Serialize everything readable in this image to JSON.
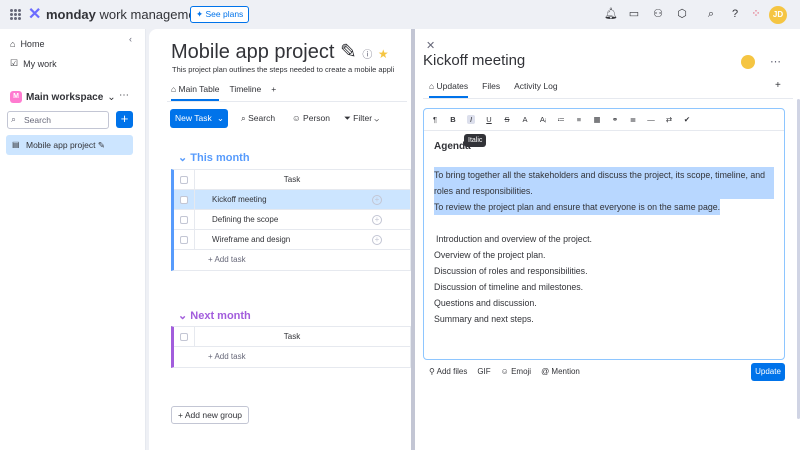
{
  "topbar": {
    "brand_bold": "monday",
    "brand_rest": " work management",
    "plans": "See plans",
    "avatar": "JD"
  },
  "sidebar": {
    "home": "Home",
    "mywork": "My work",
    "workspace": "Main workspace",
    "ws_badge": "M",
    "search_placeholder": "Search",
    "board": "Mobile app project"
  },
  "main": {
    "title": "Mobile app project",
    "desc": "This project plan outlines the steps needed to create a mobile appli",
    "tabs": [
      "Main Table",
      "Timeline"
    ],
    "new_task": "New Task",
    "tools": [
      "Search",
      "Person",
      "Filter"
    ],
    "groups": [
      {
        "name": "This month",
        "color": "#579bfc",
        "header": "Task",
        "rows": [
          "Kickoff meeting",
          "Defining the scope",
          "Wireframe and design"
        ],
        "add": "+ Add task"
      },
      {
        "name": "Next month",
        "color": "#a25ddc",
        "header": "Task",
        "rows": [],
        "add": "+ Add task"
      }
    ],
    "add_group": "Add new group"
  },
  "panel": {
    "title": "Kickoff meeting",
    "tabs": [
      "Updates",
      "Files",
      "Activity Log"
    ],
    "tooltip": "Italic",
    "heading": "Agenda",
    "lines_hl": [
      "To bring together all the stakeholders and discuss the project, its scope, timeline, and roles and responsibilities.",
      "To review the project plan and ensure that everyone is on the same page."
    ],
    "lines": [
      "Introduction and overview of the project.",
      "Overview of the project plan.",
      "Discussion of roles and responsibilities.",
      "Discussion of timeline and milestones.",
      "Questions and discussion.",
      "Summary and next steps."
    ],
    "actions": [
      "Add files",
      "GIF",
      "Emoji",
      "Mention"
    ],
    "update": "Update"
  }
}
